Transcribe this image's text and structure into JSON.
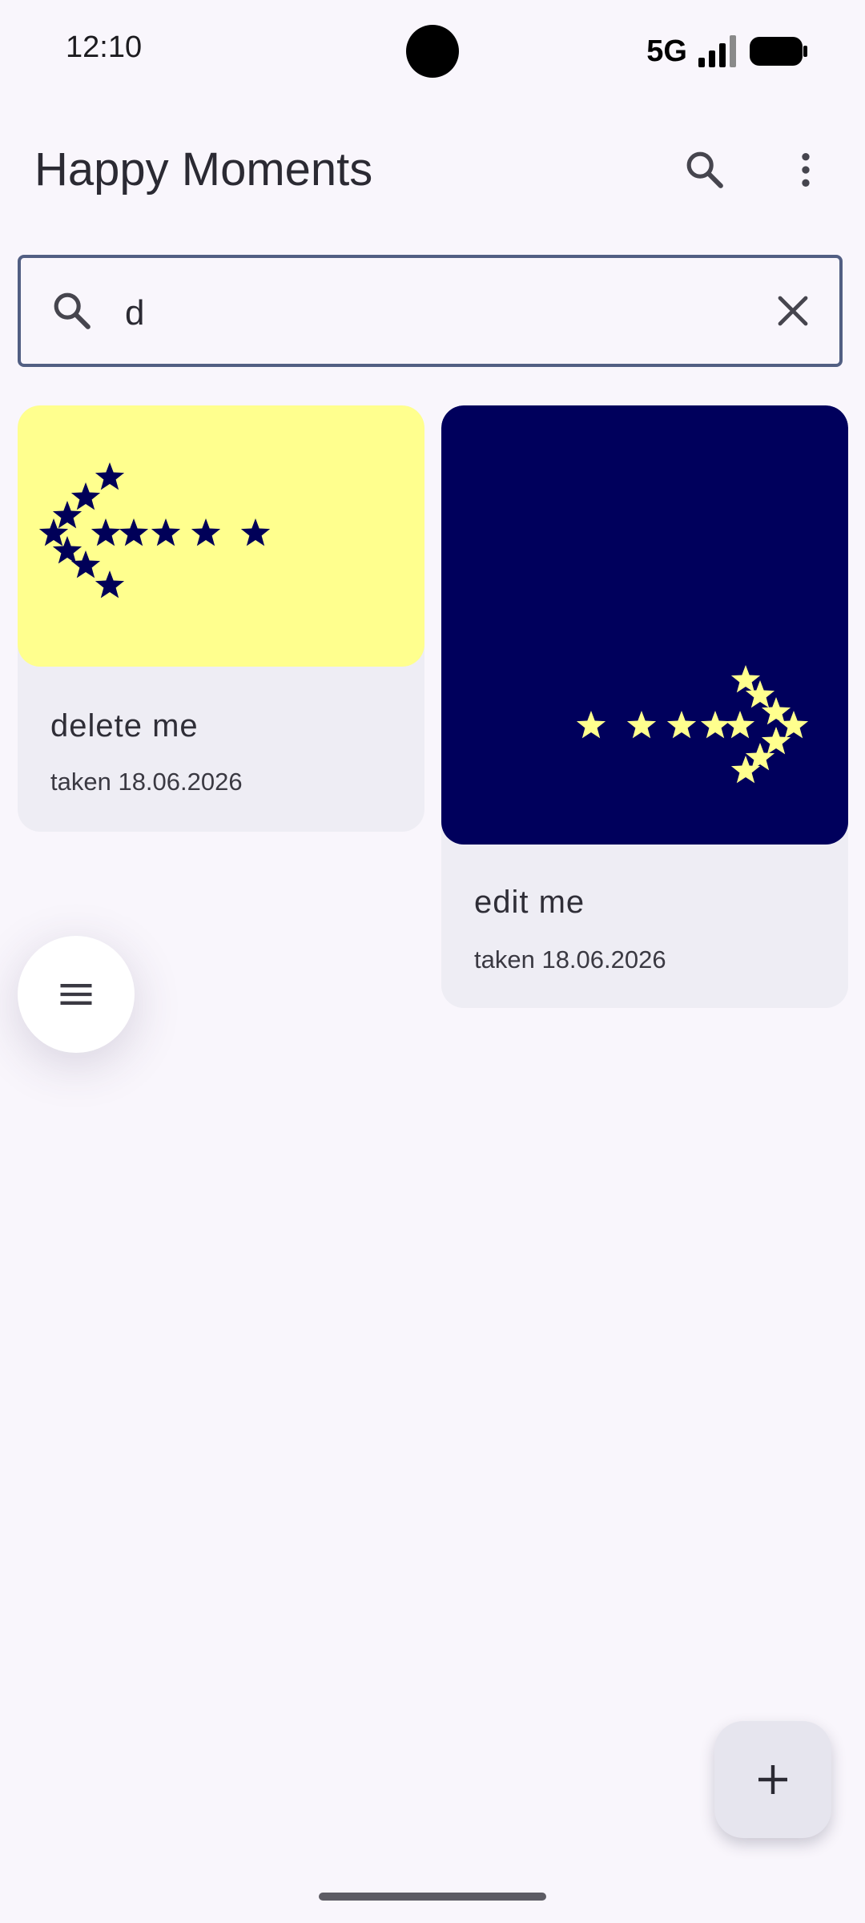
{
  "status_bar": {
    "time": "12:10",
    "network": "5G"
  },
  "app_bar": {
    "title": "Happy Moments",
    "icons": [
      "search-icon",
      "more-vert-icon"
    ]
  },
  "search": {
    "query": "d",
    "icons": [
      "search-icon",
      "close-icon"
    ]
  },
  "cards": [
    {
      "title": "delete me",
      "subtitle": "taken 18.06.2026",
      "thumb_background": "#ffff8e",
      "star_color": "#000058",
      "arrow_direction": "left"
    },
    {
      "title": "edit me",
      "subtitle": "taken 18.06.2026",
      "thumb_background": "#00005c",
      "star_color": "#ffff8e",
      "arrow_direction": "right"
    }
  ],
  "fabs": {
    "menu_icon": "menu-icon",
    "add_icon": "add-icon"
  },
  "colors": {
    "background": "#f9f6fc",
    "card_background": "#eeedf4",
    "search_border": "#525f83"
  }
}
